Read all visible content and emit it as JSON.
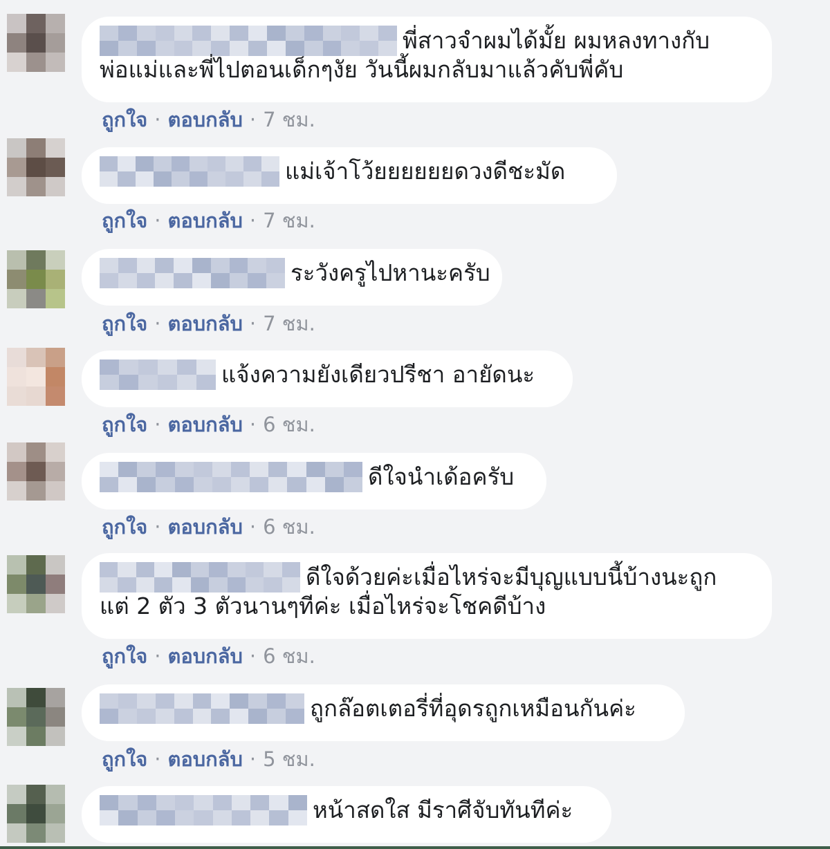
{
  "actions": {
    "like": "ถูกใจ",
    "reply": "ตอบกลับ"
  },
  "colors": {
    "background": "#f2f3f5",
    "bubble": "#ffffff",
    "text": "#1c1e21",
    "link": "#4b67a1",
    "meta": "#90949c"
  },
  "comments": [
    {
      "name": "[blurred]",
      "lines": [
        "พี่สาวจำผมได้มั้ย ผมหลงทางกับ",
        "พ่อแม่และพี่ไปตอนเด็กๆงัย วันนี้ผมกลับมาแล้วคับพี่คับ"
      ],
      "time": "7 ชม."
    },
    {
      "name": "[blurred]",
      "lines": [
        "แม่เจ้าโว้ยยยยยยดวงดีชะมัด"
      ],
      "time": "7 ชม."
    },
    {
      "name": "[blurred]",
      "lines": [
        "ระวังครูไปหานะครับ"
      ],
      "time": "7 ชม."
    },
    {
      "name": "[blurred]",
      "lines": [
        "แจ้งความยังเดียวปรีชา อายัดนะ"
      ],
      "time": "6 ชม."
    },
    {
      "name": "[blurred]",
      "lines": [
        "ดีใจนำเด้อครับ"
      ],
      "time": "6 ชม."
    },
    {
      "name": "[blurred]",
      "lines": [
        "ดีใจด้วยค่ะเมื่อไหร่จะมีบุญแบบนี้บ้างนะถูก",
        "แต่ 2 ตัว 3 ตัวนานๆทีค่ะ เมื่อไหร่จะโชคดีบ้าง"
      ],
      "time": "6 ชม."
    },
    {
      "name": "[blurred]",
      "lines": [
        "ถูกล๊อตเตอรี่ที่อุดรถูกเหมือนกันค่ะ"
      ],
      "time": "5 ชม."
    },
    {
      "name": "[blurred]",
      "lines": [
        "หน้าสดใส มีราศีจับทันทีค่ะ"
      ],
      "time": ""
    }
  ]
}
